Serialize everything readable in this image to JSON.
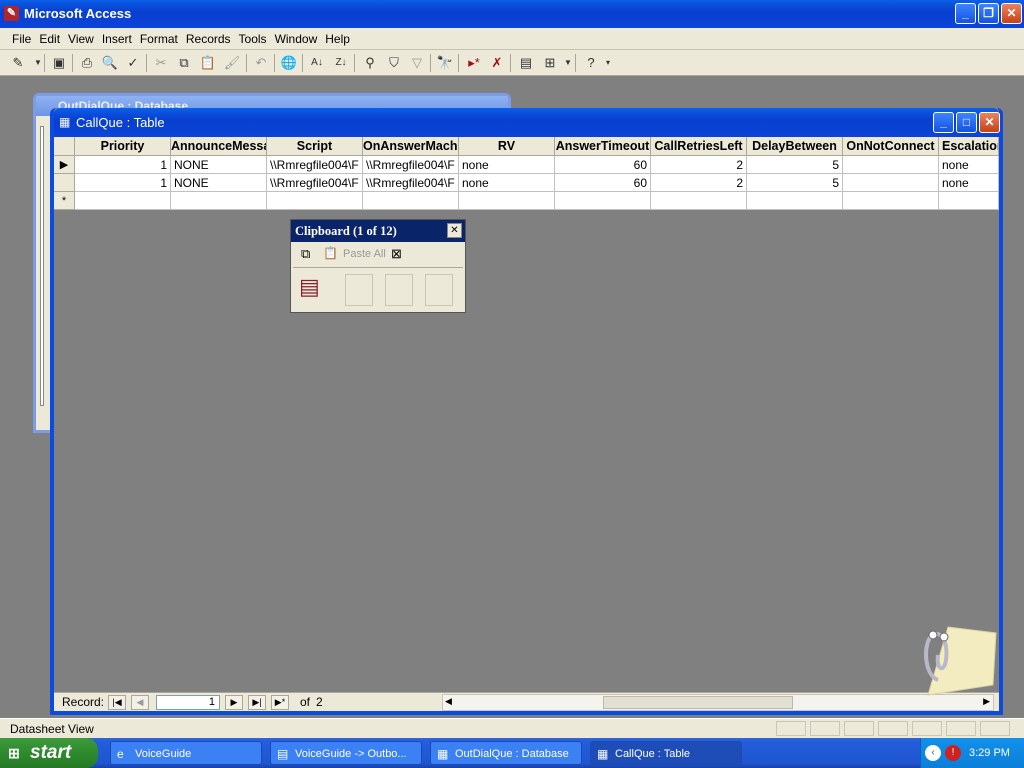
{
  "app": {
    "title": "Microsoft Access"
  },
  "menu": [
    "File",
    "Edit",
    "View",
    "Insert",
    "Format",
    "Records",
    "Tools",
    "Window",
    "Help"
  ],
  "background_window": {
    "title": "OutDialQue : Database"
  },
  "table_window": {
    "title": "CallQue : Table",
    "columns": [
      "Priority",
      "AnnounceMessage",
      "Script",
      "OnAnswerMachine",
      "RV",
      "AnswerTimeout",
      "CallRetriesLeft",
      "DelayBetween",
      "OnNotConnect",
      "Escalation"
    ],
    "rows": [
      [
        "1",
        "NONE",
        "\\\\Rmregfile004\\F",
        "\\\\Rmregfile004\\F",
        "none",
        "60",
        "2",
        "5",
        "",
        "none"
      ],
      [
        "1",
        "NONE",
        "\\\\Rmregfile004\\F",
        "\\\\Rmregfile004\\F",
        "none",
        "60",
        "2",
        "5",
        "",
        "none"
      ]
    ],
    "new_row_marker": "*",
    "current_row_marker": "▶"
  },
  "navigation": {
    "label": "Record:",
    "current": "1",
    "of_label": "of",
    "total": "2"
  },
  "clipboard": {
    "title": "Clipboard (1 of 12)",
    "paste_all": "Paste All"
  },
  "status": {
    "text": "Datasheet View"
  },
  "taskbar": {
    "start": "start",
    "tasks": [
      "VoiceGuide",
      "VoiceGuide -> Outbo...",
      "OutDialQue : Database",
      "CallQue : Table"
    ],
    "clock": "3:29 PM"
  }
}
